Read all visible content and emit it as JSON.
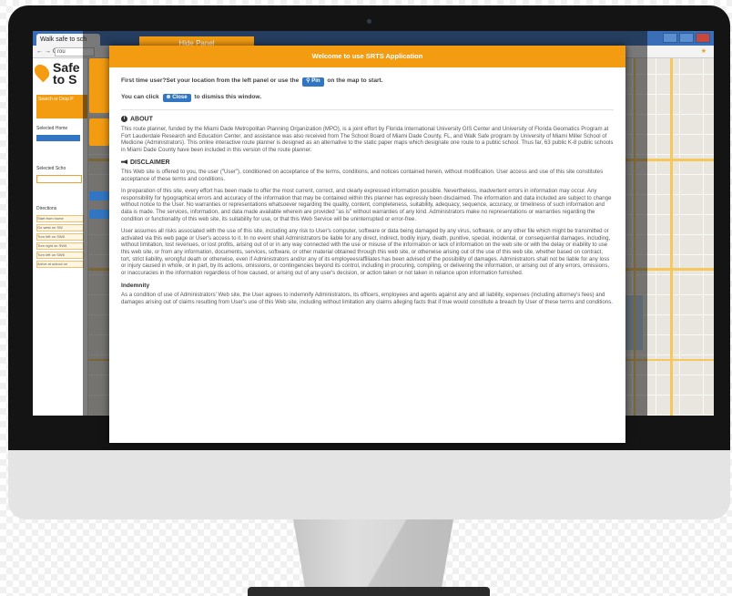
{
  "browser": {
    "tab_title": "Walk safe to sch",
    "url": "rou",
    "nav": "← → C"
  },
  "left_panel": {
    "title": "Safe to S",
    "search_label": "Search or Drop P",
    "selected_home": "Selected Home",
    "selected_school": "Selected Scho",
    "directions": "Directions",
    "direction_rows": [
      "Start from home",
      "Go west on SW",
      "Turn left on SW6",
      "Turn right on SW6",
      "Turn left on SW6",
      "Arrive at school on"
    ]
  },
  "hide_panel": "Hide Panel",
  "modal": {
    "header": "Welcome to use SRTS Application",
    "intro_line1_pre": "First time user?Set your location from the left panel or use the",
    "pin_label": "Pin",
    "intro_line1_post": "on the map to start.",
    "intro_line2_pre": "You can click",
    "close_label": "Close",
    "intro_line2_post": "to dismiss this window.",
    "about_head": "ABOUT",
    "about_text": "This route planner, funded by the Miami Dade Metropolitan Planning Organization (MPO), is a joint effort by Florida International University GIS Center and University of Florida Geomatics Program at Fort Lauderdale Research and Education Center, and assistance was also received from The School Board of Miami Dade County, FL, and Walk Safe program by University of Miami Miller School of Medicine (Administrators). This online interactive route planner is designed as an alternative to the static paper maps which designate one route to a public school. Thus far, 63 public K-8 public schools in Miami Dade County have been included in this version of the route planner.",
    "disclaimer_head": "DISCLAIMER",
    "disclaimer_p1": "This Web site is offered to you, the user (\"User\"), conditioned on acceptance of the terms, conditions, and notices contained herein, without modification. User access and use of this site constitutes acceptance of these terms and conditions.",
    "disclaimer_p2": "In preparation of this site, every effort has been made to offer the most current, correct, and clearly expressed information possible. Nevertheless, inadvertent errors in information may occur. Any responsibility for typographical errors and accuracy of the information that may be contained within this planner has expressly been disclaimed. The information and data included are subject to change without notice to the User. No warranties or representations whatsoever regarding the quality, content, completeness, suitability, adequacy, sequence, accuracy, or timeliness of such information and data is made. The services, information, and data made available wherein are provided \"as is\" without warranties of any kind. Administrators make no representations or warranties regarding the condition or functionality of this web site, its suitability for use, or that this Web Service will be uninterrupted or error-free.",
    "disclaimer_p3": "User assumes all risks associated with the use of this site, including any risk to User's computer, software or data being damaged by any virus, software, or any other file which might be transmitted or activated via this web page or User's access to it. In no event shall Administrators be liable for any direct, indirect, bodily injury, death, punitive, special, incidental, or consequential damages, including, without limitation, lost revenues, or lost profits, arising out of or in any way connected with the use or misuse of the information or lack of information on the web site or with the delay or inability to use this web site, or from any information, documents, services, software, or other material obtained through this web site, or otherwise arising out of the use of this web site, whether based on contract, tort, strict liability, wrongful death or otherwise, even if Administrators and/or any of its employees/affiliates has been advised of the possibility of damages. Administrators shall not be liable for any loss or injury caused in whole, or in part, by its actions, omissions, or contingencies beyond its control, including in procuring, compiling, or delivering the information, or arising out of any errors, omissions, or inaccuracies in the information regardless of how caused, or arising out of any user's decision, or action taken or not taken in reliance upon information furnished.",
    "indemnity_head": "Indemnity",
    "indemnity_text": "As a condition of use of Administrators' Web site, the User agrees to indemnify Administrators, its officers, employees and agents against any and all liability, expenses (including attorney's fees) and damages arising out of claims resulting from User's use of this Web site, including without limitation any claims alleging facts that if true would constitute a breach by User of these terms and conditions."
  },
  "colors": {
    "accent": "#f39c12",
    "button": "#3276c3"
  }
}
